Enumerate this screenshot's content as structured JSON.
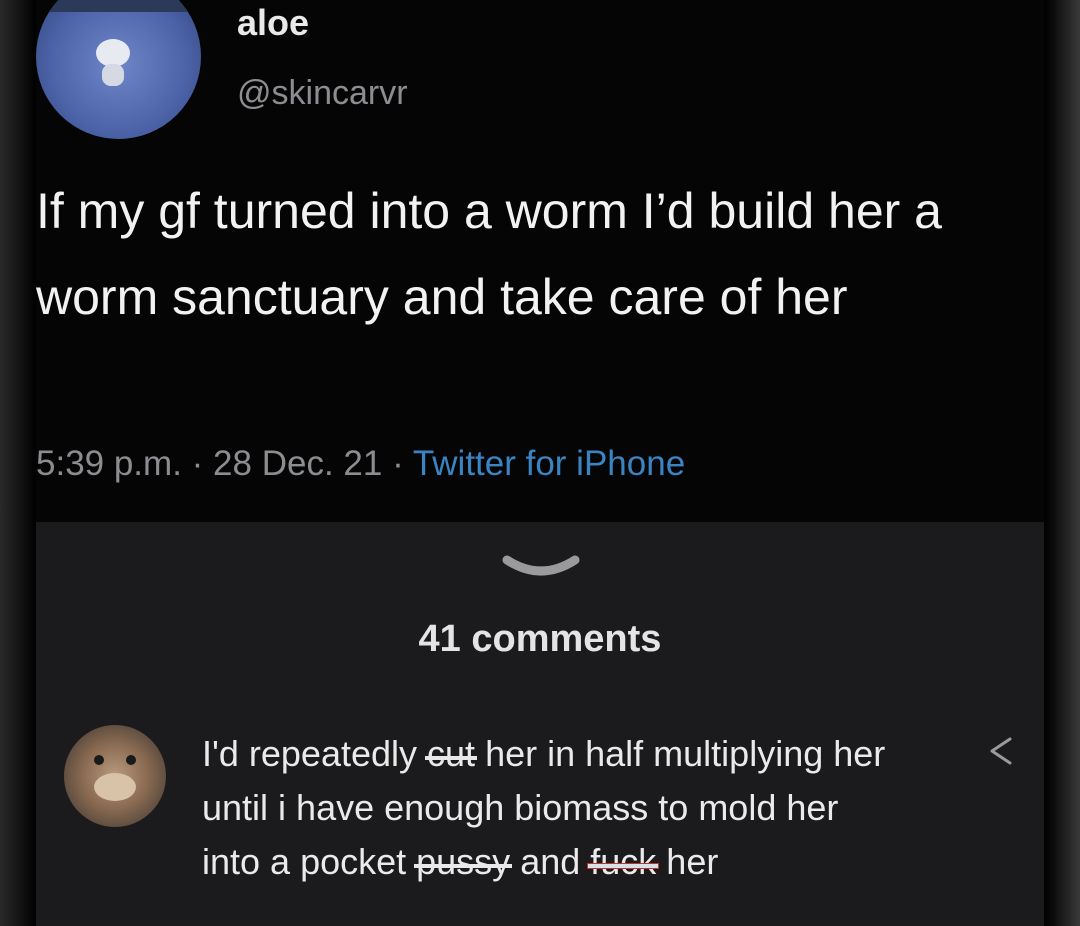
{
  "tweet": {
    "display_name": "aloe",
    "handle": "@skincarvr",
    "text": "If my gf turned into a worm I’d build her a worm sanctuary and take care of her",
    "time": "5:39 p.m.",
    "date": "28 Dec. 21",
    "separator": "·",
    "source": "Twitter for iPhone"
  },
  "comments": {
    "count_label": "41 comments",
    "items": [
      {
        "parts": {
          "p1": "I'd repeatedly ",
          "s1": "cut",
          "p2": " her in half multiplying her until i have enough biomass to mold her into a pocket ",
          "s2": "pussy",
          "p3": " and ",
          "s3": "fuck",
          "p4": " her"
        }
      }
    ]
  },
  "icons": {
    "expand": "chevron-down-icon",
    "share": "share-icon"
  },
  "colors": {
    "background": "#000000",
    "panel": "#1b1b1d",
    "link": "#3a84c4",
    "muted": "#8b8d91"
  }
}
